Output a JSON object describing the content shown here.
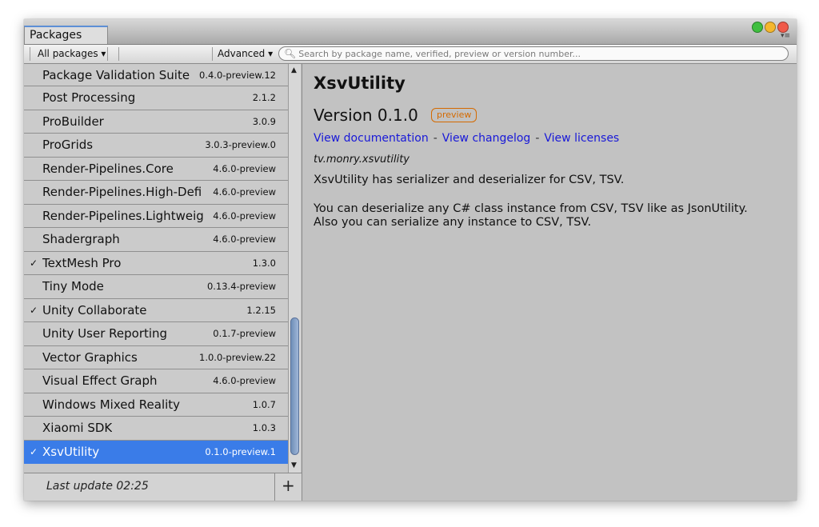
{
  "window": {
    "tab_label": "Packages",
    "traffic_lights": [
      "#3fbf3f",
      "#f5b72d",
      "#f05a4a"
    ]
  },
  "toolbar": {
    "filter_label": "All packages ▾",
    "advanced_label": "Advanced ▾",
    "search_placeholder": "Search by package name, verified, preview or version number..."
  },
  "packages": [
    {
      "check": "",
      "name": "Package Validation Suite",
      "version": "0.4.0-preview.12"
    },
    {
      "check": "",
      "name": "Post Processing",
      "version": "2.1.2"
    },
    {
      "check": "",
      "name": "ProBuilder",
      "version": "3.0.9"
    },
    {
      "check": "",
      "name": "ProGrids",
      "version": "3.0.3-preview.0"
    },
    {
      "check": "",
      "name": "Render-Pipelines.Core",
      "version": "4.6.0-preview"
    },
    {
      "check": "",
      "name": "Render-Pipelines.High-Defi",
      "version": "4.6.0-preview"
    },
    {
      "check": "",
      "name": "Render-Pipelines.Lightweig",
      "version": "4.6.0-preview"
    },
    {
      "check": "",
      "name": "Shadergraph",
      "version": "4.6.0-preview"
    },
    {
      "check": "✓",
      "name": "TextMesh Pro",
      "version": "1.3.0"
    },
    {
      "check": "",
      "name": "Tiny Mode",
      "version": "0.13.4-preview"
    },
    {
      "check": "✓",
      "name": "Unity Collaborate",
      "version": "1.2.15"
    },
    {
      "check": "",
      "name": "Unity User Reporting",
      "version": "0.1.7-preview"
    },
    {
      "check": "",
      "name": "Vector Graphics",
      "version": "1.0.0-preview.22"
    },
    {
      "check": "",
      "name": "Visual Effect Graph",
      "version": "4.6.0-preview"
    },
    {
      "check": "",
      "name": "Windows Mixed Reality",
      "version": "1.0.7"
    },
    {
      "check": "",
      "name": "Xiaomi SDK",
      "version": "1.0.3"
    },
    {
      "check": "✓",
      "name": "XsvUtility",
      "version": "0.1.0-preview.1",
      "selected": true
    }
  ],
  "status": {
    "last_update": "Last update 02:25",
    "add_label": "+"
  },
  "detail": {
    "title": "XsvUtility",
    "version": "Version 0.1.0",
    "badge": "preview",
    "link_docs": "View documentation",
    "link_changelog": "View changelog",
    "link_licenses": "View licenses",
    "sep": "-",
    "package_id": "tv.monry.xsvutility",
    "description_1": "XsvUtility has serializer and deserializer for CSV, TSV.",
    "description_2a": "You can deserialize any C# class instance from CSV, TSV like as JsonUtility.",
    "description_2b": "Also you can serialize any instance to CSV, TSV."
  }
}
